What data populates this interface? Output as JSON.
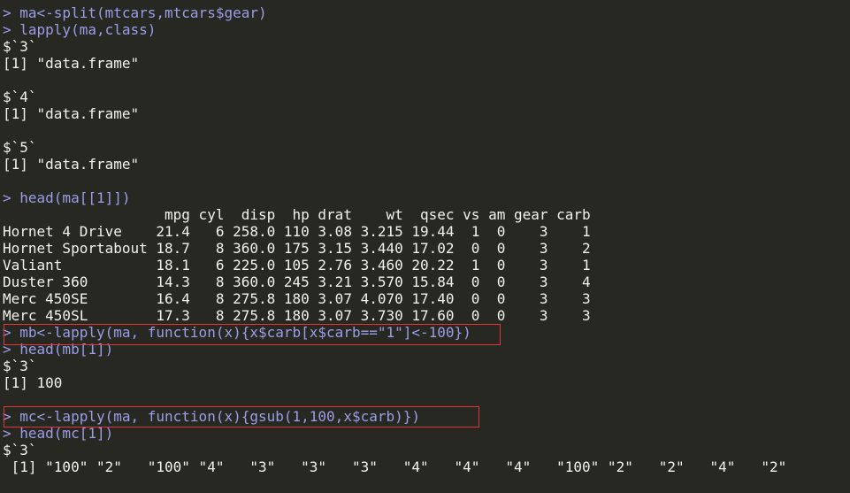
{
  "lines": [
    {
      "type": "cmd",
      "text": "> ma<-split(mtcars,mtcars$gear)"
    },
    {
      "type": "cmd",
      "text": "> lapply(ma,class)"
    },
    {
      "type": "out",
      "text": "$`3`"
    },
    {
      "type": "out",
      "text": "[1] \"data.frame\""
    },
    {
      "type": "blank",
      "text": ""
    },
    {
      "type": "out",
      "text": "$`4`"
    },
    {
      "type": "out",
      "text": "[1] \"data.frame\""
    },
    {
      "type": "blank",
      "text": ""
    },
    {
      "type": "out",
      "text": "$`5`"
    },
    {
      "type": "out",
      "text": "[1] \"data.frame\""
    },
    {
      "type": "blank",
      "text": ""
    },
    {
      "type": "cmd",
      "text": "> head(ma[[1]])"
    },
    {
      "type": "out",
      "text": "                   mpg cyl  disp  hp drat    wt  qsec vs am gear carb"
    },
    {
      "type": "out",
      "text": "Hornet 4 Drive    21.4   6 258.0 110 3.08 3.215 19.44  1  0    3    1"
    },
    {
      "type": "out",
      "text": "Hornet Sportabout 18.7   8 360.0 175 3.15 3.440 17.02  0  0    3    2"
    },
    {
      "type": "out",
      "text": "Valiant           18.1   6 225.0 105 2.76 3.460 20.22  1  0    3    1"
    },
    {
      "type": "out",
      "text": "Duster 360        14.3   8 360.0 245 3.21 3.570 15.84  0  0    3    4"
    },
    {
      "type": "out",
      "text": "Merc 450SE        16.4   8 275.8 180 3.07 4.070 17.40  0  0    3    3"
    },
    {
      "type": "out",
      "text": "Merc 450SL        17.3   8 275.8 180 3.07 3.730 17.60  0  0    3    3"
    },
    {
      "type": "cmd",
      "text": "> mb<-lapply(ma, function(x){x$carb[x$carb==\"1\"]<-100})"
    },
    {
      "type": "cmd",
      "text": "> head(mb[1])"
    },
    {
      "type": "out",
      "text": "$`3`"
    },
    {
      "type": "out",
      "text": "[1] 100"
    },
    {
      "type": "blank",
      "text": ""
    },
    {
      "type": "cmd",
      "text": "> mc<-lapply(ma, function(x){gsub(1,100,x$carb)})"
    },
    {
      "type": "cmd",
      "text": "> head(mc[1])"
    },
    {
      "type": "out",
      "text": "$`3`"
    },
    {
      "type": "out",
      "text": " [1] \"100\" \"2\"   \"100\" \"4\"   \"3\"   \"3\"   \"3\"   \"4\"   \"4\"   \"4\"   \"100\" \"2\"   \"2\"   \"4\"   \"2\""
    }
  ],
  "colors": {
    "background": "#272822",
    "command": "#9d9ce8",
    "output": "#f2f2ec",
    "highlight_border": "#e0353b"
  }
}
